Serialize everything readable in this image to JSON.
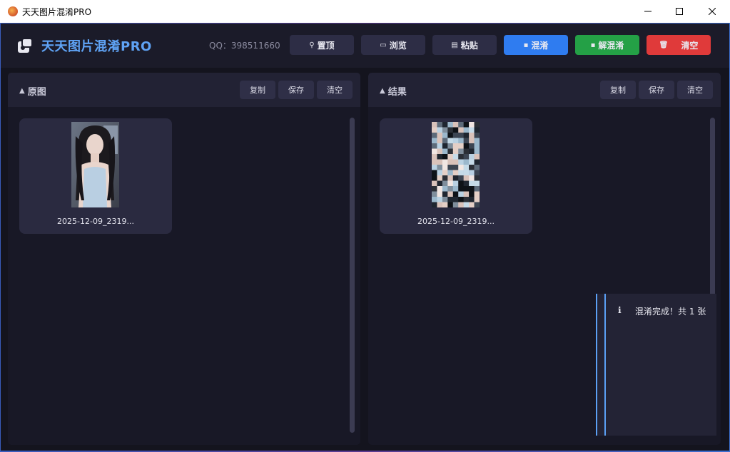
{
  "window": {
    "title": "天天图片混淆PRO",
    "minimize_icon": "minimize-icon",
    "maximize_icon": "maximize-icon",
    "close_icon": "close-icon"
  },
  "header": {
    "app_name": "天天图片混淆PRO",
    "qq_text": "QQ：398511660",
    "buttons": [
      {
        "label": "置顶",
        "icon": "pin-icon",
        "color": "#2d2d45"
      },
      {
        "label": "浏览",
        "icon": "folder-icon",
        "color": "#2d2d45"
      },
      {
        "label": "粘贴",
        "icon": "clipboard-icon",
        "color": "#2d2d45"
      },
      {
        "label": "混淆",
        "icon": "lock-icon",
        "color": "#2f7cf0"
      },
      {
        "label": "解混淆",
        "icon": "unlock-icon",
        "color": "#24a046"
      },
      {
        "label": "清空",
        "icon": "trash-icon",
        "color": "#e03a3a"
      }
    ]
  },
  "panels": {
    "original": {
      "title": "原图",
      "buttons": [
        "复制",
        "保存",
        "清空"
      ],
      "image": {
        "filename": "2025-12-09_2319..."
      }
    },
    "result": {
      "title": "结果",
      "buttons": [
        "复制",
        "保存",
        "清空"
      ],
      "image": {
        "filename": "2025-12-09_2319..."
      }
    }
  },
  "toast": {
    "icon": "ℹ",
    "message": "混淆完成！共 1 张"
  },
  "colors": {
    "accent": "#5fa3f5",
    "bg": "#14141e",
    "panel": "#181826"
  }
}
